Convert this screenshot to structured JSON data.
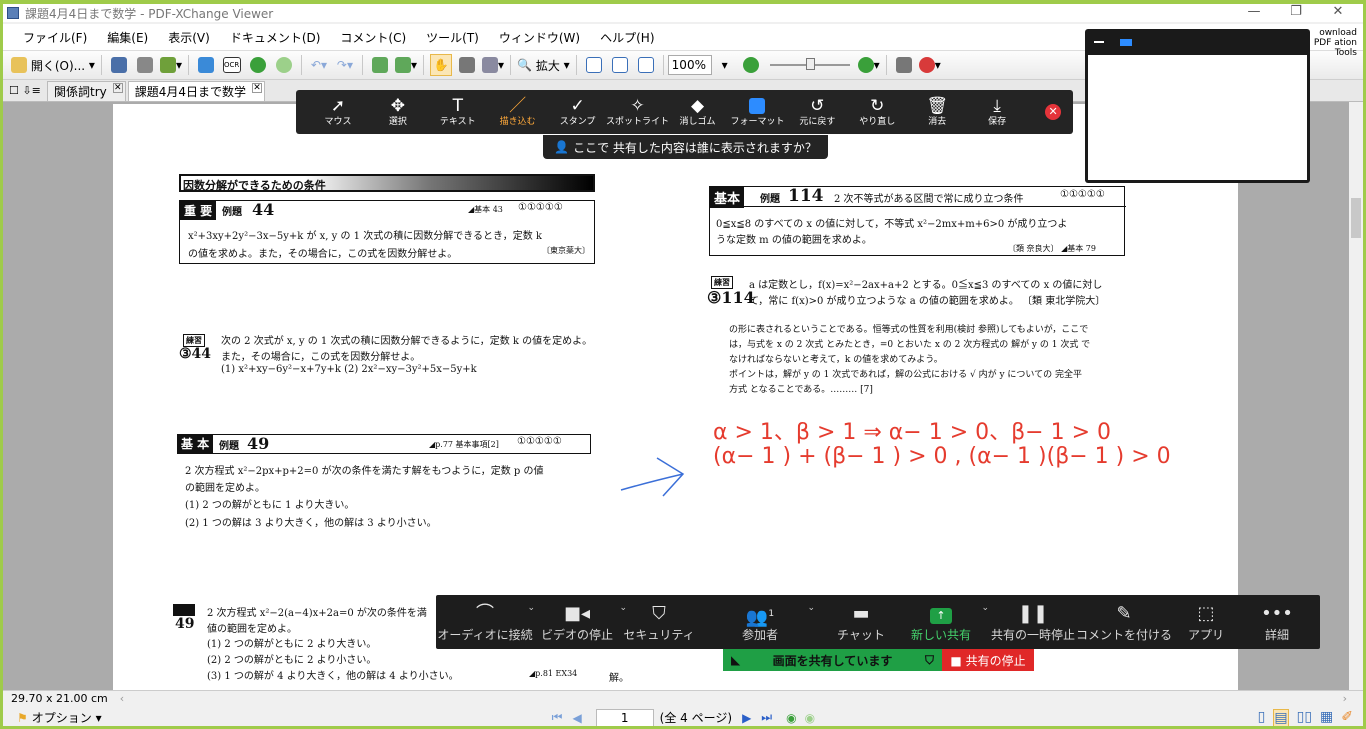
{
  "window": {
    "title": "課題4月4日まで数学 - PDF-XChange Viewer"
  },
  "menu": [
    "ファイル(F)",
    "編集(E)",
    "表示(V)",
    "ドキュメント(D)",
    "コメント(C)",
    "ツール(T)",
    "ウィンドウ(W)",
    "ヘルプ(H)"
  ],
  "toolbar": {
    "open_label": "開く(O)...",
    "zoom_label": "拡大",
    "zoom_value": "100%"
  },
  "tabs": [
    {
      "label": "関係詞try"
    },
    {
      "label": "課題4月4日まで数学"
    }
  ],
  "download_text": "ownload PDF ation Tools",
  "annotate": {
    "tools": [
      "マウス",
      "選択",
      "テキスト",
      "描き込む",
      "スタンプ",
      "スポットライト",
      "消しゴム",
      "フォーマット",
      "元に戻す",
      "やり直し",
      "消去",
      "保存"
    ],
    "who_sees": "ここで 共有した内容は誰に表示されますか？"
  },
  "doc": {
    "h1": "因数分解ができるための条件",
    "p44_tag": "重 要",
    "p44_ex": "例題",
    "p44_num": "44",
    "p44_ref": "◢基本 43",
    "p44_circles": "①①①①①",
    "p44_text1": "x²+3xy+2y²−3x−5y+k が x, y の 1 次式の積に因数分解できるとき，定数 k",
    "p44_text2": "の値を求めよ。また，その場合に，この式を因数分解せよ。",
    "p44_src": "〔東京薬大〕",
    "r44_tag": "練習",
    "r44_num": "③44",
    "r44_text1": "次の 2 次式が x, y の 1 次式の積に因数分解できるように，定数 k の値を定めよ。",
    "r44_text2": "また，その場合に，この式を因数分解せよ。",
    "r44_text3": "(1)  x²+xy−6y²−x+7y+k          (2)  2x²−xy−3y²+5x−5y+k",
    "p49_tag": "基 本",
    "p49_ex": "例題",
    "p49_num": "49",
    "p49_ref": "◢p.77 基本事項[2]",
    "p49_circles": "①①①①①",
    "p49_text1": "2 次方程式 x²−2px+p+2=0 が次の条件を満たす解をもつように，定数 p の値",
    "p49_text2": "の範囲を定めよ。",
    "p49_text3": "(1)  2 つの解がともに 1 より大きい。",
    "p49_text4": "(2)  1 つの解は 3 より大きく，他の解は 3 より小さい。",
    "r49_num": "49",
    "r49_text1": "2 次方程式 x²−2(a−4)x+2a=0 が次の条件を満",
    "r49_text2": "値の範囲を定めよ。",
    "r49_text3": "(1)  2 つの解がともに 2 より大きい。",
    "r49_text4": "(2)  2 つの解がともに 2 より小さい。",
    "r49_text5": "(3)  1 つの解が 4 より大きく，他の解は 4 より小さい。",
    "r49_ref": "◢p.81 EX34",
    "r49_tail": "解。",
    "p114_tag": "基本",
    "p114_ex": "例題",
    "p114_num": "114",
    "p114_title": "2 次不等式がある区間で常に成り立つ条件",
    "p114_circles": "①①①①①",
    "p114_text1": "0≦x≦8 のすべての x の値に対して，不等式 x²−2mx+m+6>0 が成り立つよ",
    "p114_text2": "うな定数 m の値の範囲を求めよ。",
    "p114_src": "〔類 奈良大〕 ◢基本 79",
    "r114_tag": "練習",
    "r114_num": "③114",
    "r114_text1": "a は定数とし，f(x)=x²−2ax+a+2 とする。0≦x≦3 のすべての x の値に対し",
    "r114_text2": "て，常に f(x)>0 が成り立つような a の値の範囲を求めよ。       〔類 東北学院大〕",
    "hint1": "の形に表されるということである。恒等式の性質を利用(検討 参照)してもよいが，ここで",
    "hint2": "は，与式を x の 2 次式 とみたとき，=0 とおいた x の 2 次方程式の 解が y の 1 次式 で",
    "hint3": "なければならないと考えて，k の値を求めてみよう。",
    "hint4": "ポイントは，解が y の 1 次式であれば，解の公式における √ 内が y についての 完全平",
    "hint5": "方式 となることである。……… [7]",
    "hw_line1": "α > 1、β > 1 ⇒      α− 1 > 0、β− 1 > 0",
    "hw_line2": "(α− 1 ) + (β− 1 ) > 0 , (α− 1 )(β− 1 ) > 0"
  },
  "zoom": {
    "buttons": [
      "オーディオに接続",
      "ビデオの停止",
      "セキュリティ",
      "参加者",
      "チャット",
      "新しい共有",
      "共有の一時停止",
      "コメントを付ける",
      "アプリ",
      "詳細"
    ],
    "participants_count": "1",
    "sharing_label": "画面を共有しています",
    "stop_label": "■ 共有の停止"
  },
  "status": {
    "size": "29.70 x 21.00 cm",
    "option_label": "オプション",
    "page_value": "1",
    "page_total": "(全 4 ページ)"
  },
  "colors": {
    "annotation_red": "#e53b2e",
    "arrow_blue": "#3b6fd8",
    "share_green": "#1f9f45"
  }
}
